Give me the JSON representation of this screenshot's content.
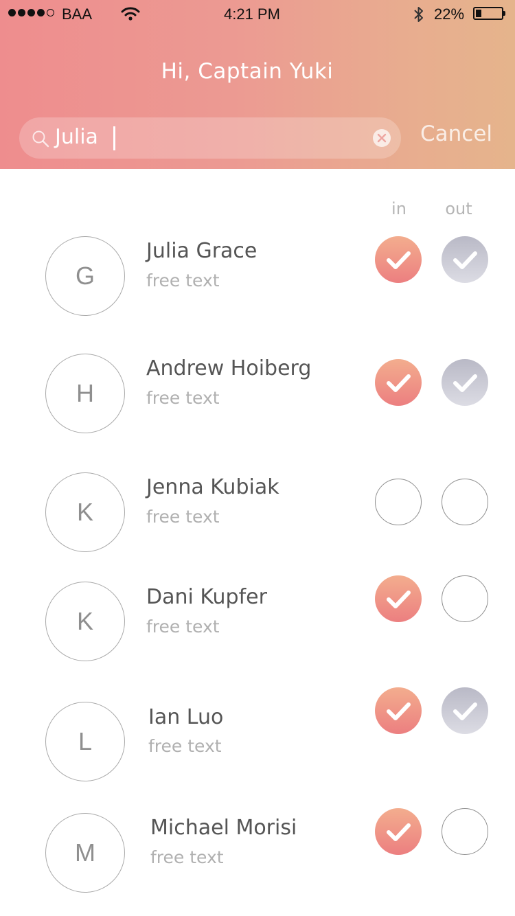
{
  "status_bar": {
    "signal_dots": 5,
    "signal_filled": 4,
    "carrier": "BAA",
    "time": "4:21 PM",
    "battery": "22%",
    "battery_level": 0.22,
    "icons": [
      "wifi-icon",
      "bluetooth-icon",
      "battery-icon"
    ]
  },
  "header": {
    "greeting": "Hi, Captain Yuki",
    "colors": {
      "gradient_start": "#ee8d8e",
      "gradient_end": "#e5b48c"
    }
  },
  "search": {
    "value": "Julia",
    "icon": "search-icon",
    "clear_icon": "clear-icon",
    "cancel_label": "Cancel"
  },
  "columns": {
    "in": "in",
    "out": "out"
  },
  "people": [
    {
      "initial": "G",
      "name": "Julia Grace",
      "note": "free text",
      "in": true,
      "out": true
    },
    {
      "initial": "H",
      "name": "Andrew Hoiberg",
      "note": "free text",
      "in": true,
      "out": true
    },
    {
      "initial": "K",
      "name": "Jenna Kubiak",
      "note": "free text",
      "in": false,
      "out": false
    },
    {
      "initial": "K",
      "name": "Dani Kupfer",
      "note": "free text",
      "in": true,
      "out": false
    },
    {
      "initial": "L",
      "name": "Ian Luo",
      "note": "free text",
      "in": true,
      "out": true
    },
    {
      "initial": "M",
      "name": "Michael Morisi",
      "note": "free text",
      "in": true,
      "out": false
    }
  ],
  "colors": {
    "check_in": "#ec7f80",
    "check_out": "#b9b9c6",
    "text_primary": "#555555",
    "text_secondary": "#b0b0b0"
  }
}
